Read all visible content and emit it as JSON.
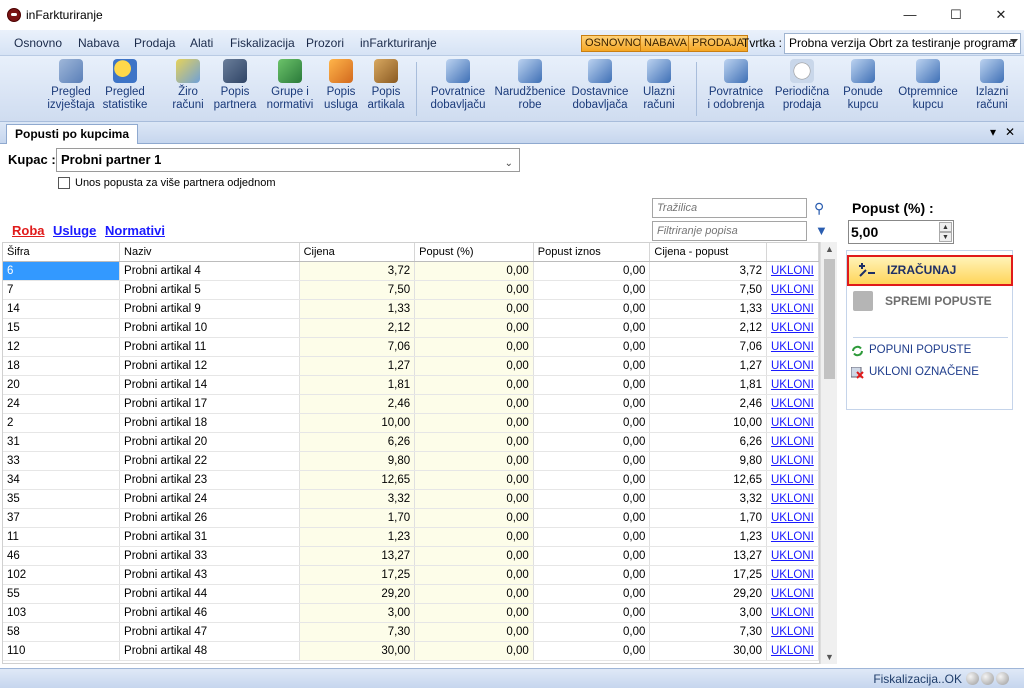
{
  "window": {
    "title": "inFarkturiranje"
  },
  "menu": [
    "Osnovno",
    "Nabava",
    "Prodaja",
    "Alati",
    "Fiskalizacija",
    "Prozori",
    "inFarkturiranje"
  ],
  "quick_tabs": [
    "OSNOVNO",
    "NABAVA",
    "PRODAJA"
  ],
  "tvrtka": {
    "label": "Tvrtka :",
    "value": "Probna verzija Obrt za testiranje programa"
  },
  "ribbon": {
    "pregled_izvjestaja": [
      "Pregled",
      "izvještaja"
    ],
    "pregled_statistike": [
      "Pregled",
      "statistike"
    ],
    "ziro_racuni": [
      "Žiro",
      "računi"
    ],
    "popis_partnera": [
      "Popis",
      "partnera"
    ],
    "grupe_normativi": [
      "Grupe i",
      "normativi"
    ],
    "popis_usluga": [
      "Popis",
      "usluga"
    ],
    "popis_artikala": [
      "Popis",
      "artikala"
    ],
    "povratnice_dobavljacu": [
      "Povratnice",
      "dobavljaču"
    ],
    "narudzbenice_robe": [
      "Narudžbenice",
      "robe"
    ],
    "dostavnice_dobavljaca": [
      "Dostavnice",
      "dobavljača"
    ],
    "ulazni_racuni": [
      "Ulazni",
      "računi"
    ],
    "povratnice_odobrenja": [
      "Povratnice",
      "i odobrenja"
    ],
    "periodicna_prodaja": [
      "Periodična",
      "prodaja"
    ],
    "ponude_kupcu": [
      "Ponude",
      "kupcu"
    ],
    "otpremnice_kupcu": [
      "Otpremnice",
      "kupcu"
    ],
    "izlazni_racuni": [
      "Izlazni",
      "računi"
    ]
  },
  "tab": {
    "label": "Popusti po kupcima"
  },
  "kupac": {
    "label": "Kupac :",
    "value": "Probni partner 1"
  },
  "multi_partner": {
    "label": "Unos popusta za više partnera odjednom",
    "checked": false
  },
  "category_links": {
    "roba": "Roba",
    "usluge": "Usluge",
    "normativi": "Normativi"
  },
  "search": {
    "trazilica_placeholder": "Tražilica",
    "filter_placeholder": "Filtriranje popisa"
  },
  "table": {
    "columns": [
      "Šifra",
      "Naziv",
      "Cijena",
      "Popust (%)",
      "Popust iznos",
      "Cijena - popust",
      ""
    ],
    "rows": [
      [
        "6",
        "Probni artikal 4",
        "3,72",
        "0,00",
        "0,00",
        "3,72",
        "UKLONI"
      ],
      [
        "7",
        "Probni artikal 5",
        "7,50",
        "0,00",
        "0,00",
        "7,50",
        "UKLONI"
      ],
      [
        "14",
        "Probni artikal 9",
        "1,33",
        "0,00",
        "0,00",
        "1,33",
        "UKLONI"
      ],
      [
        "15",
        "Probni artikal 10",
        "2,12",
        "0,00",
        "0,00",
        "2,12",
        "UKLONI"
      ],
      [
        "12",
        "Probni artikal 11",
        "7,06",
        "0,00",
        "0,00",
        "7,06",
        "UKLONI"
      ],
      [
        "18",
        "Probni artikal 12",
        "1,27",
        "0,00",
        "0,00",
        "1,27",
        "UKLONI"
      ],
      [
        "20",
        "Probni artikal 14",
        "1,81",
        "0,00",
        "0,00",
        "1,81",
        "UKLONI"
      ],
      [
        "24",
        "Probni artikal 17",
        "2,46",
        "0,00",
        "0,00",
        "2,46",
        "UKLONI"
      ],
      [
        "2",
        "Probni artikal 18",
        "10,00",
        "0,00",
        "0,00",
        "10,00",
        "UKLONI"
      ],
      [
        "31",
        "Probni artikal 20",
        "6,26",
        "0,00",
        "0,00",
        "6,26",
        "UKLONI"
      ],
      [
        "33",
        "Probni artikal 22",
        "9,80",
        "0,00",
        "0,00",
        "9,80",
        "UKLONI"
      ],
      [
        "34",
        "Probni artikal 23",
        "12,65",
        "0,00",
        "0,00",
        "12,65",
        "UKLONI"
      ],
      [
        "35",
        "Probni artikal 24",
        "3,32",
        "0,00",
        "0,00",
        "3,32",
        "UKLONI"
      ],
      [
        "37",
        "Probni artikal 26",
        "1,70",
        "0,00",
        "0,00",
        "1,70",
        "UKLONI"
      ],
      [
        "11",
        "Probni artikal 31",
        "1,23",
        "0,00",
        "0,00",
        "1,23",
        "UKLONI"
      ],
      [
        "46",
        "Probni artikal 33",
        "13,27",
        "0,00",
        "0,00",
        "13,27",
        "UKLONI"
      ],
      [
        "102",
        "Probni artikal 43",
        "17,25",
        "0,00",
        "0,00",
        "17,25",
        "UKLONI"
      ],
      [
        "55",
        "Probni artikal 44",
        "29,20",
        "0,00",
        "0,00",
        "29,20",
        "UKLONI"
      ],
      [
        "103",
        "Probni artikal 46",
        "3,00",
        "0,00",
        "0,00",
        "3,00",
        "UKLONI"
      ],
      [
        "58",
        "Probni artikal 47",
        "7,30",
        "0,00",
        "0,00",
        "7,30",
        "UKLONI"
      ],
      [
        "110",
        "Probni artikal 48",
        "30,00",
        "0,00",
        "0,00",
        "30,00",
        "UKLONI"
      ]
    ]
  },
  "popust": {
    "label": "Popust (%) :",
    "value": "5,00"
  },
  "actions": {
    "izracunaj": "IZRAČUNAJ",
    "spremi": "SPREMI POPUSTE",
    "popuni": "POPUNI POPUSTE",
    "ukloni": "UKLONI OZNAČENE"
  },
  "status": {
    "text": "Fiskalizacija..OK"
  },
  "colors": {
    "highlight_border": "#e01a1a",
    "selected_cell": "#3399ff",
    "link_red": "#e01a1a",
    "link_blue": "#1a1aff"
  }
}
